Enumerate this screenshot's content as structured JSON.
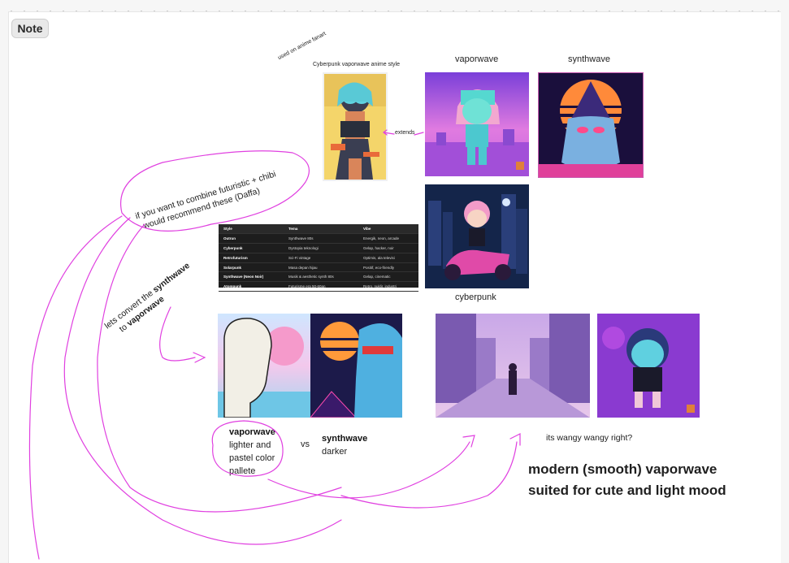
{
  "toolbar": {
    "note_label": "Note"
  },
  "annotations": {
    "fanart_note": "used on anime fanart",
    "source_title": "Cyberpunk vaporwave anime style",
    "extends": "extends",
    "vaporwave_title": "vaporwave",
    "synthwave_title": "synthwave",
    "cyberpunk_title": "cyberpunk",
    "bubble_line1": "if you want to combine futuristic + chibi",
    "bubble_line2": "would recommend these (Daffa)",
    "convert_prefix": "lets convert the ",
    "convert_bold1": "synthwave",
    "convert_to": "to ",
    "convert_bold2": "vaporwave",
    "vapor_label": "vaporwave",
    "vapor_desc1": "lighter and",
    "vapor_desc2": "pastel color",
    "vapor_desc3": "pallete",
    "vs": "vs",
    "synth_label": "synthwave",
    "synth_desc": "darker",
    "wangy": "its wangy wangy right?",
    "modern": "modern (smooth) vaporwave suited for cute and light mood"
  },
  "style_table": {
    "headers": [
      "Style",
      "Tema",
      "Vibe"
    ],
    "rows": [
      [
        "Outrun",
        "Synthwave 80s",
        "Energik, neon, arcade"
      ],
      [
        "Cyberpunk",
        "Dystopia teknologi",
        "Gelap, hacker, noir"
      ],
      [
        "Retrofuturism",
        "Sci-Fi vintage",
        "Optimis, ala televisi"
      ],
      [
        "Solarpunk",
        "Masa depan hijau",
        "Positif, eco-friendly"
      ],
      [
        "Synthwave (Neon Noir)",
        "Musik & aesthetic synth 80s",
        "Gelap, cinematic"
      ],
      [
        "Atompunk",
        "Futurisme era 50-60an",
        "Retro, nuklir, industri"
      ]
    ]
  },
  "images": [
    {
      "name": "source-anime-image",
      "alt": "anime girl with goggles"
    },
    {
      "name": "vaporwave-chibi-image",
      "alt": "vaporwave chibi"
    },
    {
      "name": "synthwave-wizard-image",
      "alt": "synthwave wizard"
    },
    {
      "name": "cyberpunk-chibi-image",
      "alt": "cyberpunk chibi on motorbike"
    },
    {
      "name": "vapor-synth-split-image",
      "alt": "vaporwave vs synthwave"
    },
    {
      "name": "street-scene-image",
      "alt": "pastel street"
    },
    {
      "name": "chibi-3d-image",
      "alt": "3d chibi"
    }
  ],
  "colors": {
    "annotation_pen": "#e040e0",
    "table_bg": "#1d1d1d"
  }
}
